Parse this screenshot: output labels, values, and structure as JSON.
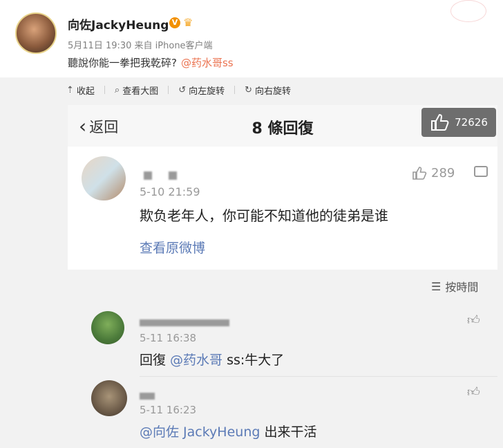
{
  "post": {
    "author": "向佐JackyHeung",
    "meta": "5月11日 19:30 来自 iPhone客户端",
    "text": "聽說你能一拳把我乾碎?",
    "mention": "@药水哥ss"
  },
  "toolbar": {
    "collapse": "收起",
    "view_large": "查看大图",
    "rotate_left": "向左旋转",
    "rotate_right": "向右旋转"
  },
  "shot": {
    "back_label": "返回",
    "title": "8 條回復",
    "like_count": "72626",
    "main_comment": {
      "time": "5-10 21:59",
      "text": "欺负老年人，你可能不知道他的徒弟是谁",
      "view_original": "查看原微博",
      "likes": "289"
    },
    "sort_label": "按時間",
    "replies": [
      {
        "time": "5-11 16:38",
        "prefix": "回復 ",
        "mention": "@药水哥",
        "suffix": " ss:牛大了"
      },
      {
        "time": "5-11 16:23",
        "prefix": "",
        "mention": "@向佐 JackyHeung",
        "suffix": "  出来干活"
      }
    ]
  },
  "colors": {
    "accent_orange": "#eb7350",
    "link_blue": "#5b7ab6",
    "like_box": "#6e6e6e"
  }
}
